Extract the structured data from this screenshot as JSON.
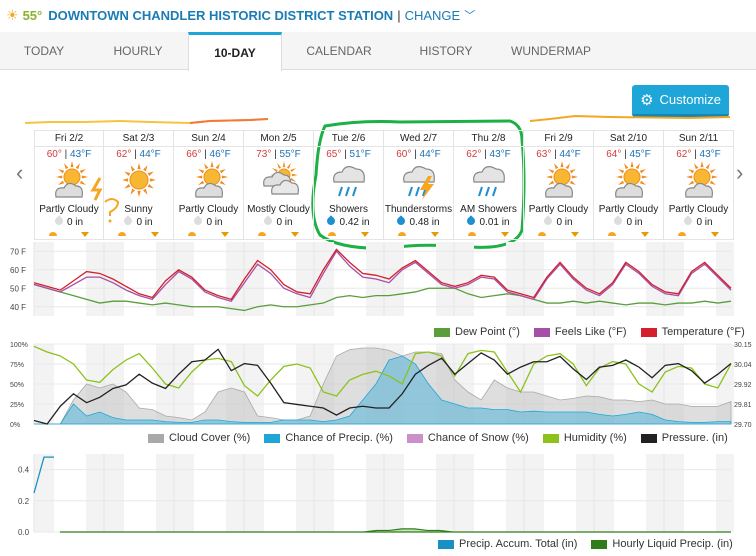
{
  "location": {
    "current_temp": "55°",
    "station": "DOWNTOWN CHANDLER HISTORIC DISTRICT STATION",
    "separator": "|",
    "change_label": "CHANGE",
    "weather_icon": "sun-icon"
  },
  "tabs": [
    {
      "label": "TODAY",
      "active": false
    },
    {
      "label": "HOURLY",
      "active": false
    },
    {
      "label": "10-DAY",
      "active": true
    },
    {
      "label": "CALENDAR",
      "active": false
    },
    {
      "label": "HISTORY",
      "active": false
    },
    {
      "label": "WUNDERMAP",
      "active": false
    }
  ],
  "customize_label": "Customize",
  "nav": {
    "prev": "‹",
    "next": "›"
  },
  "days": [
    {
      "date": "Fri 2/2",
      "hi": "60°",
      "lo": "43°F",
      "condition": "Partly Cloudy",
      "icon": "partly-cloudy",
      "precip": "0 in"
    },
    {
      "date": "Sat 2/3",
      "hi": "62°",
      "lo": "44°F",
      "condition": "Sunny",
      "icon": "sunny",
      "precip": "0 in"
    },
    {
      "date": "Sun 2/4",
      "hi": "66°",
      "lo": "46°F",
      "condition": "Partly Cloudy",
      "icon": "partly-cloudy",
      "precip": "0 in"
    },
    {
      "date": "Mon 2/5",
      "hi": "73°",
      "lo": "55°F",
      "condition": "Mostly Cloudy",
      "icon": "mostly-cloudy",
      "precip": "0 in"
    },
    {
      "date": "Tue 2/6",
      "hi": "65°",
      "lo": "51°F",
      "condition": "Showers",
      "icon": "showers",
      "precip": "0.42 in"
    },
    {
      "date": "Wed 2/7",
      "hi": "60°",
      "lo": "44°F",
      "condition": "Thunderstorms",
      "icon": "thunderstorms",
      "precip": "0.48 in"
    },
    {
      "date": "Thu 2/8",
      "hi": "62°",
      "lo": "43°F",
      "condition": "AM Showers",
      "icon": "showers",
      "precip": "0.01 in"
    },
    {
      "date": "Fri 2/9",
      "hi": "63°",
      "lo": "44°F",
      "condition": "Partly Cloudy",
      "icon": "partly-cloudy",
      "precip": "0 in"
    },
    {
      "date": "Sat 2/10",
      "hi": "64°",
      "lo": "45°F",
      "condition": "Partly Cloudy",
      "icon": "partly-cloudy",
      "precip": "0 in"
    },
    {
      "date": "Sun 2/11",
      "hi": "62°",
      "lo": "43°F",
      "condition": "Partly Cloudy",
      "icon": "partly-cloudy",
      "precip": "0 in"
    }
  ],
  "chart_data": [
    {
      "type": "line",
      "title": "Temperature",
      "y_ticks": [
        "70 F",
        "60 F",
        "50 F",
        "40 F"
      ],
      "ylim": [
        35,
        75
      ],
      "series": [
        {
          "name": "Dew Point (°)",
          "color": "#5a9e3c",
          "values": [
            52,
            50,
            48,
            46,
            44,
            42,
            43,
            43,
            42,
            41,
            42,
            41,
            40,
            40,
            40,
            39,
            38,
            40,
            41,
            40,
            40,
            41,
            42,
            45,
            46,
            45,
            46,
            46,
            47,
            48,
            50,
            50,
            50,
            47,
            45,
            46,
            47,
            46,
            44,
            42,
            42,
            43,
            42,
            43,
            42,
            41,
            42,
            42,
            41,
            42,
            42,
            43,
            42,
            43
          ]
        },
        {
          "name": "Feels Like (°F)",
          "color": "#a64fa6",
          "values": [
            52,
            50,
            48,
            52,
            56,
            56,
            53,
            49,
            46,
            44,
            52,
            59,
            55,
            48,
            45,
            43,
            53,
            63,
            58,
            50,
            47,
            45,
            58,
            70,
            62,
            56,
            55,
            53,
            60,
            64,
            58,
            52,
            50,
            52,
            56,
            55,
            48,
            46,
            44,
            55,
            63,
            55,
            49,
            46,
            52,
            63,
            58,
            51,
            47,
            46,
            58,
            63,
            56,
            49
          ]
        },
        {
          "name": "Temperature (°F)",
          "color": "#d3202a",
          "values": [
            53,
            51,
            49,
            54,
            59,
            58,
            55,
            51,
            47,
            45,
            54,
            60,
            56,
            49,
            46,
            44,
            55,
            65,
            60,
            52,
            48,
            47,
            60,
            71,
            64,
            58,
            57,
            55,
            61,
            65,
            59,
            53,
            51,
            53,
            57,
            56,
            49,
            47,
            45,
            56,
            64,
            56,
            50,
            47,
            53,
            64,
            59,
            52,
            48,
            47,
            59,
            64,
            57,
            50
          ]
        }
      ],
      "legend": "bottom-right"
    },
    {
      "type": "area",
      "title": "Cloud / Precip / Humidity / Pressure",
      "y_ticks_left": [
        "100%",
        "75%",
        "50%",
        "25%",
        "0%"
      ],
      "y_ticks_right": [
        "30.15",
        "30.04",
        "29.92",
        "29.81",
        "29.70"
      ],
      "ylim_left": [
        0,
        100
      ],
      "ylim_right": [
        29.7,
        30.15
      ],
      "series": [
        {
          "name": "Cloud Cover (%)",
          "color": "#a9a9a9",
          "values": [
            0,
            0,
            0,
            30,
            50,
            45,
            50,
            40,
            20,
            18,
            10,
            8,
            5,
            15,
            40,
            45,
            40,
            10,
            8,
            5,
            5,
            10,
            50,
            85,
            93,
            95,
            95,
            92,
            85,
            90,
            90,
            88,
            55,
            40,
            30,
            55,
            45,
            40,
            40,
            35,
            30,
            32,
            35,
            34,
            30,
            30,
            28,
            30,
            25,
            25,
            22,
            22,
            22,
            28
          ]
        },
        {
          "name": "Chance of Precip. (%)",
          "color": "#1ea6d8",
          "values": [
            0,
            0,
            0,
            25,
            10,
            15,
            8,
            5,
            5,
            5,
            3,
            2,
            2,
            5,
            5,
            3,
            2,
            2,
            2,
            5,
            5,
            5,
            3,
            5,
            10,
            30,
            50,
            80,
            85,
            75,
            50,
            30,
            25,
            20,
            20,
            18,
            18,
            15,
            16,
            15,
            15,
            15,
            15,
            12,
            10,
            12,
            15,
            12,
            5,
            3,
            2,
            2,
            3,
            3
          ]
        },
        {
          "name": "Chance of Snow (%)",
          "color": "#c990c9",
          "values": []
        },
        {
          "name": "Humidity (%)",
          "color": "#8cc21a",
          "values": [
            97,
            90,
            85,
            75,
            55,
            52,
            68,
            80,
            88,
            70,
            50,
            45,
            65,
            80,
            82,
            78,
            48,
            35,
            55,
            72,
            75,
            70,
            40,
            35,
            55,
            62,
            66,
            60,
            50,
            88,
            90,
            85,
            60,
            88,
            92,
            90,
            65,
            40,
            75,
            85,
            88,
            75,
            48,
            70,
            78,
            75,
            50,
            40,
            65,
            72,
            70,
            50,
            45,
            75
          ]
        },
        {
          "name": "Pressure. (in)",
          "color": "#222222",
          "values": [
            29.72,
            29.7,
            29.8,
            29.87,
            29.82,
            29.85,
            29.9,
            29.92,
            29.98,
            29.93,
            29.9,
            29.98,
            30.05,
            30.06,
            30.12,
            30.0,
            30.04,
            30.03,
            29.93,
            29.82,
            29.81,
            29.8,
            29.79,
            29.75,
            29.79,
            29.8,
            29.79,
            29.79,
            29.87,
            29.98,
            30.03,
            30.07,
            29.98,
            30.04,
            30.1,
            30.06,
            29.98,
            30.02,
            30.05,
            30.05,
            30.08,
            30.01,
            29.95,
            30.02,
            30.03,
            30.06,
            30.02,
            29.96,
            30.03,
            30.04,
            30.0,
            29.93,
            29.98,
            30.04
          ]
        }
      ],
      "legend": "bottom-right"
    },
    {
      "type": "area",
      "title": "Precipitation",
      "y_ticks": [
        "0.4",
        "0.2",
        "0.0"
      ],
      "ylim": [
        0,
        0.5
      ],
      "series": [
        {
          "name": "Precip. Accum. Total (in)",
          "color": "#1a8fc4",
          "values": [
            0.25,
            0.48,
            0.48
          ]
        },
        {
          "name": "Hourly Liquid Precip. (in)",
          "color": "#2e7d1a",
          "values": [
            0,
            0,
            0,
            0,
            0,
            0,
            0,
            0,
            0,
            0,
            0,
            0,
            0,
            0,
            0,
            0,
            0,
            0,
            0,
            0,
            0,
            0,
            0,
            0,
            0,
            0.01,
            0.01,
            0.02,
            0.02,
            0.01,
            0.01,
            0,
            0,
            0,
            0,
            0,
            0,
            0,
            0,
            0,
            0,
            0,
            0,
            0,
            0,
            0,
            0,
            0,
            0,
            0,
            0,
            0,
            0,
            0
          ]
        }
      ],
      "legend": "bottom-right"
    }
  ]
}
